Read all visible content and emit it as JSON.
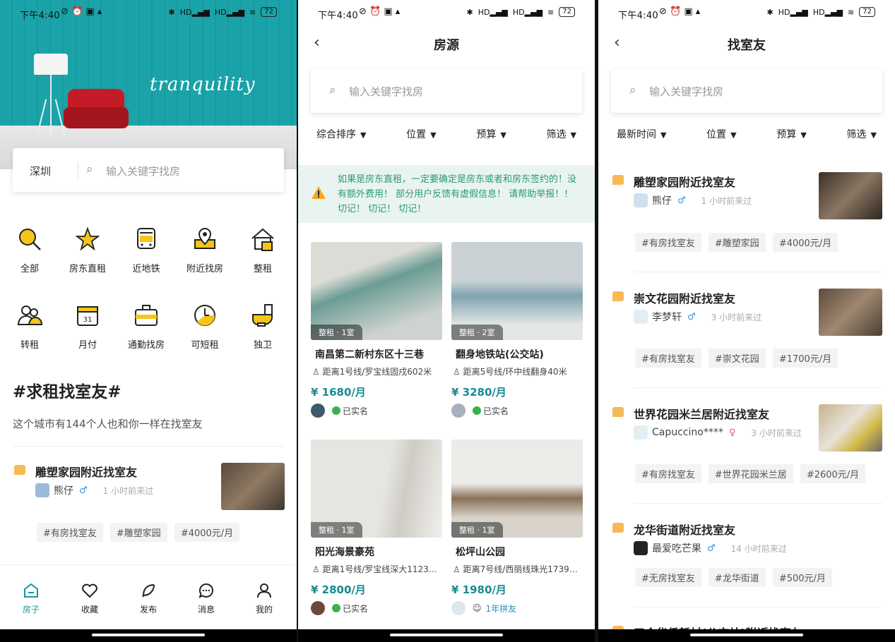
{
  "status_bar": {
    "time": "下午4:40",
    "net1": "HD",
    "net2": "HD",
    "battery": "72"
  },
  "colors": {
    "teal": "#17989d",
    "price": "#178a8f",
    "notice_text": "#2a9a72",
    "flag": "#f7b955"
  },
  "home": {
    "brand": "tranquility",
    "city": "深圳",
    "search_placeholder": "输入关键字找房",
    "categories": [
      {
        "label": "全部",
        "icon": "search-icon"
      },
      {
        "label": "房东直租",
        "icon": "star-icon"
      },
      {
        "label": "近地铁",
        "icon": "bus-icon"
      },
      {
        "label": "附近找房",
        "icon": "map-pin-icon"
      },
      {
        "label": "整租",
        "icon": "house-icon"
      },
      {
        "label": "转租",
        "icon": "people-icon"
      },
      {
        "label": "月付",
        "icon": "calendar-icon"
      },
      {
        "label": "通勤找房",
        "icon": "briefcase-icon"
      },
      {
        "label": "可短租",
        "icon": "clock-icon"
      },
      {
        "label": "独卫",
        "icon": "toilet-icon"
      }
    ],
    "section_title": "#求租找室友#",
    "section_subtitle": "这个城市有144个人也和你一样在找室友",
    "roommate": {
      "title": "雕塑家园附近找室友",
      "user": "熊仔",
      "sex": "♂",
      "time": "1 小时前来过",
      "tags": [
        "#有房找室友",
        "#雕塑家园",
        "#4000元/月"
      ]
    },
    "tabs": [
      {
        "label": "房子",
        "icon": "house-tab-icon"
      },
      {
        "label": "收藏",
        "icon": "heart-icon"
      },
      {
        "label": "发布",
        "icon": "feather-icon"
      },
      {
        "label": "消息",
        "icon": "chat-icon"
      },
      {
        "label": "我的",
        "icon": "user-icon"
      }
    ]
  },
  "listings": {
    "title": "房源",
    "search_placeholder": "输入关键字找房",
    "filters": [
      "综合排序",
      "位置",
      "预算",
      "筛选"
    ],
    "notice": "如果是房东直租，一定要确定是房东或者和房东签约的！没有额外费用！ 部分用户反馈有虚假信息！ 请帮助举报！！切记！ 切记！ 切记！",
    "cards": [
      {
        "badge": "整租 · 1室",
        "name": "南昌第二新村东区十三巷",
        "distance": "距离1号线/罗宝线固戍602米",
        "price": "¥ 1680/月",
        "owner_status": "已实名",
        "img_color": "#8fb0a8"
      },
      {
        "badge": "整租 · 2室",
        "name": "翻身地铁站(公交站)",
        "distance": "距离5号线/环中线翻身40米",
        "price": "¥ 3280/月",
        "owner_status": "已实名",
        "img_color": "#9fb3bd"
      },
      {
        "badge": "整租 · 1室",
        "name": "阳光海景豪苑",
        "distance": "距离1号线/罗宝线深大1123…",
        "price": "¥ 2800/月",
        "owner_status": "已实名",
        "img_color": "#d9d8d4"
      },
      {
        "badge": "整租 · 1室",
        "name": "松坪山公园",
        "distance": "距离7号线/西丽线珠光1739…",
        "price": "¥ 1980/月",
        "owner_status": "1年拼友",
        "img_color": "#b9b6ad"
      }
    ]
  },
  "roommates": {
    "title": "找室友",
    "search_placeholder": "输入关键字找房",
    "filters": [
      "最新时间",
      "位置",
      "预算",
      "筛选"
    ],
    "posts": [
      {
        "title": "雕塑家园附近找室友",
        "user": "熊仔",
        "sex": "♂",
        "time": "1 小时前来过",
        "tags": [
          "#有房找室友",
          "#雕塑家园",
          "#4000元/月"
        ],
        "img_color": "#6b5a4a"
      },
      {
        "title": "崇文花园附近找室友",
        "user": "李梦轩",
        "sex": "♂",
        "time": "3 小时前来过",
        "tags": [
          "#有房找室友",
          "#崇文花园",
          "#1700元/月"
        ],
        "img_color": "#7a6658"
      },
      {
        "title": "世界花园米兰居附近找室友",
        "user": "Capuccino****",
        "sex": "♀",
        "time": "3 小时前来过",
        "tags": [
          "#有房找室友",
          "#世界花园米兰居",
          "#2600元/月"
        ],
        "img_color": "#b0a48e"
      },
      {
        "title": "龙华街道附近找室友",
        "user": "最爱吃芒果",
        "sex": "♂",
        "time": "14 小时前来过",
        "tags": [
          "#无房找室友",
          "#龙华街道",
          "#500元/月"
        ],
        "img_color": ""
      }
    ],
    "partial_title": "三合华侨新村(公交站)附近找室友"
  }
}
